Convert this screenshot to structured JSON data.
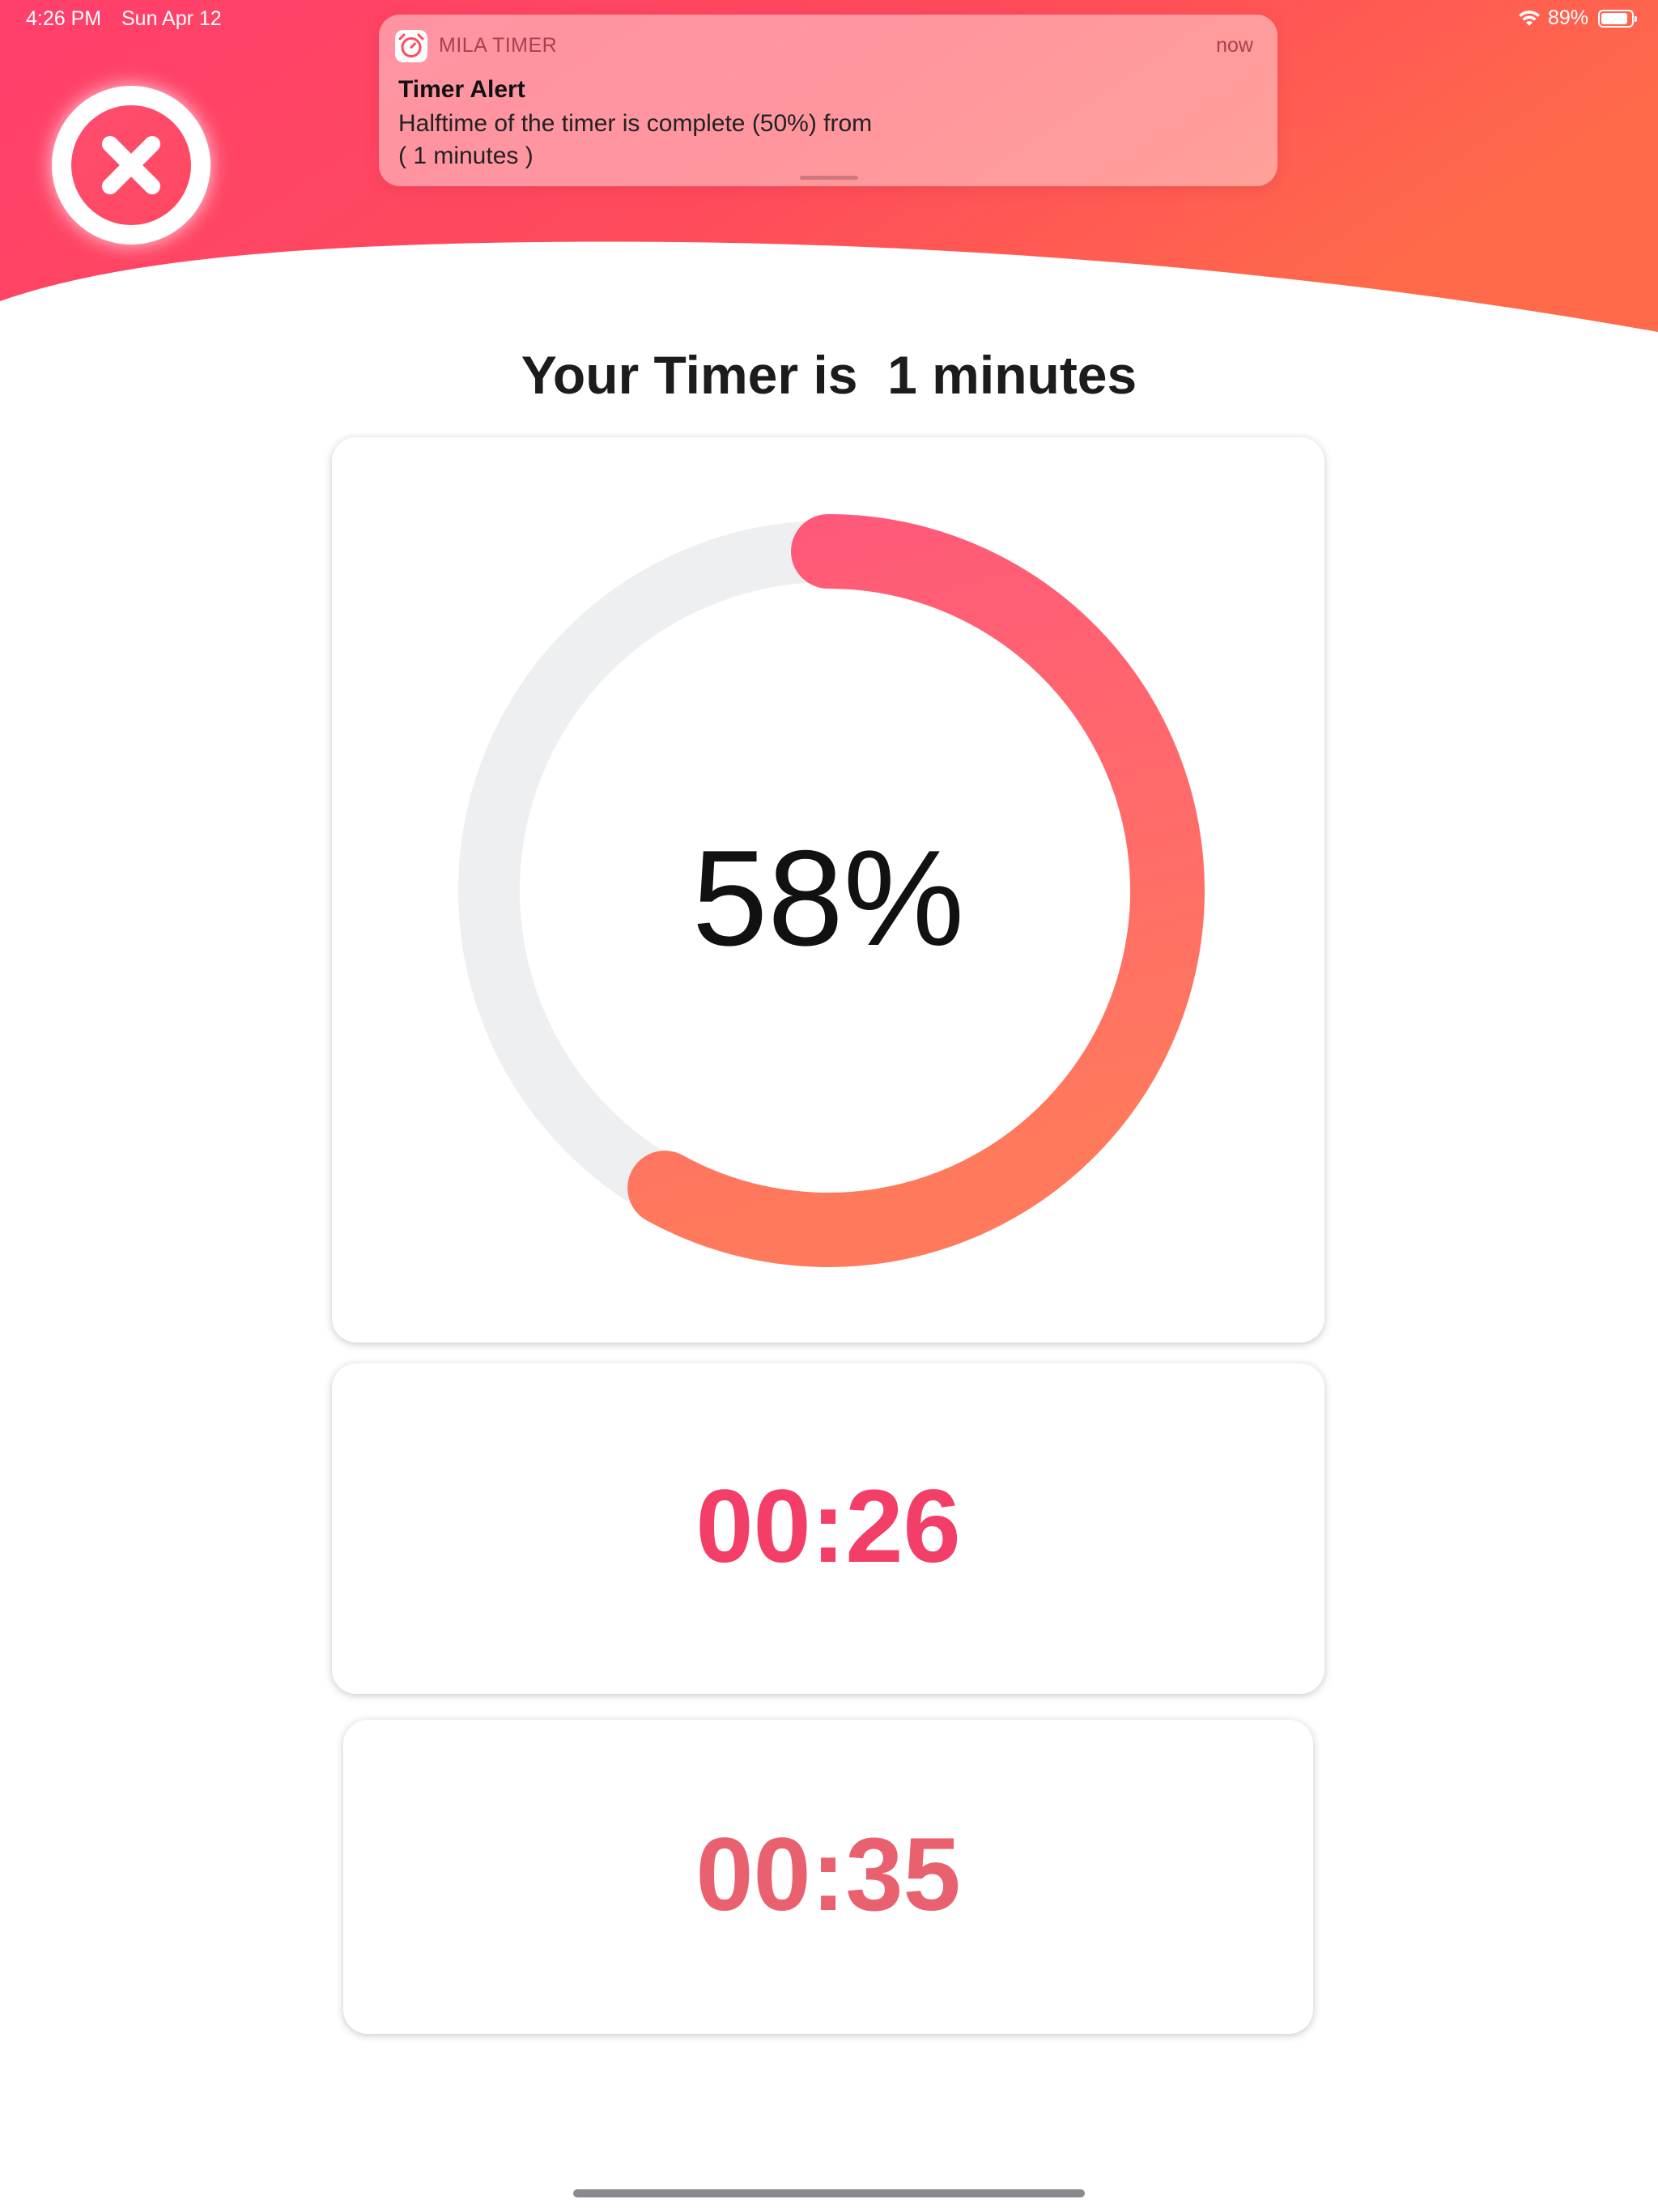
{
  "status_bar": {
    "time": "4:26 PM",
    "date": "Sun Apr 12",
    "battery": "89%",
    "battery_level": 0.89
  },
  "notification": {
    "app_icon": "alarm-clock-icon",
    "app_name": "MILA TIMER",
    "time": "now",
    "title": "Timer Alert",
    "body": "Halftime of the timer is complete (50%) from\n( 1 minutes )"
  },
  "close_button": {
    "icon": "close-icon"
  },
  "timer": {
    "title": "Your Timer is  1 minutes",
    "progress_percent": 58,
    "progress_label": "58%",
    "elapsed": "00:26",
    "remaining": "00:35"
  },
  "colors": {
    "header_gradient_start": "#ff3f6c",
    "header_gradient_end": "#ff6a4a",
    "progress_start": "#ff587a",
    "progress_end": "#ff7a5c",
    "track": "#eeeff0",
    "elapsed_text": "#f33e68",
    "remaining_text": "#e9616e"
  }
}
